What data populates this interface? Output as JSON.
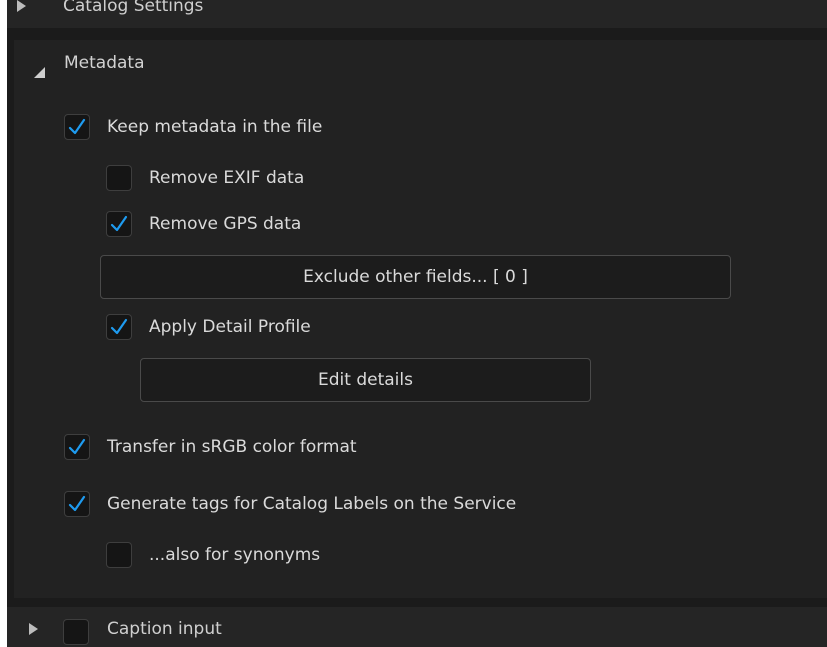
{
  "colors": {
    "background": "#1b1b1b",
    "panel": "#222222",
    "accent_check": "#1e9bf0",
    "text": "#dadada"
  },
  "sections": {
    "top": {
      "title": "Catalog Settings",
      "expanded": false
    },
    "metadata": {
      "title": "Metadata",
      "expanded": true
    },
    "bottom": {
      "title": "Caption input",
      "expanded": false
    }
  },
  "options": {
    "keep_metadata": {
      "label": "Keep metadata in the file",
      "checked": true
    },
    "remove_exif": {
      "label": "Remove EXIF data",
      "checked": false
    },
    "remove_gps": {
      "label": "Remove GPS data",
      "checked": true
    },
    "exclude_button": {
      "label": "Exclude other fields... [ 0 ]"
    },
    "apply_detail": {
      "label": "Apply Detail Profile",
      "checked": true
    },
    "edit_details_button": {
      "label": "Edit details"
    },
    "transfer_srgb": {
      "label": "Transfer in sRGB color format",
      "checked": true
    },
    "generate_tags": {
      "label": "Generate tags for Catalog Labels on the Service",
      "checked": true
    },
    "also_synonyms": {
      "label": "...also for synonyms",
      "checked": false
    }
  },
  "icons": {
    "check": "checkmark-icon",
    "expand": "triangle-down-icon",
    "collapse": "triangle-right-icon"
  }
}
